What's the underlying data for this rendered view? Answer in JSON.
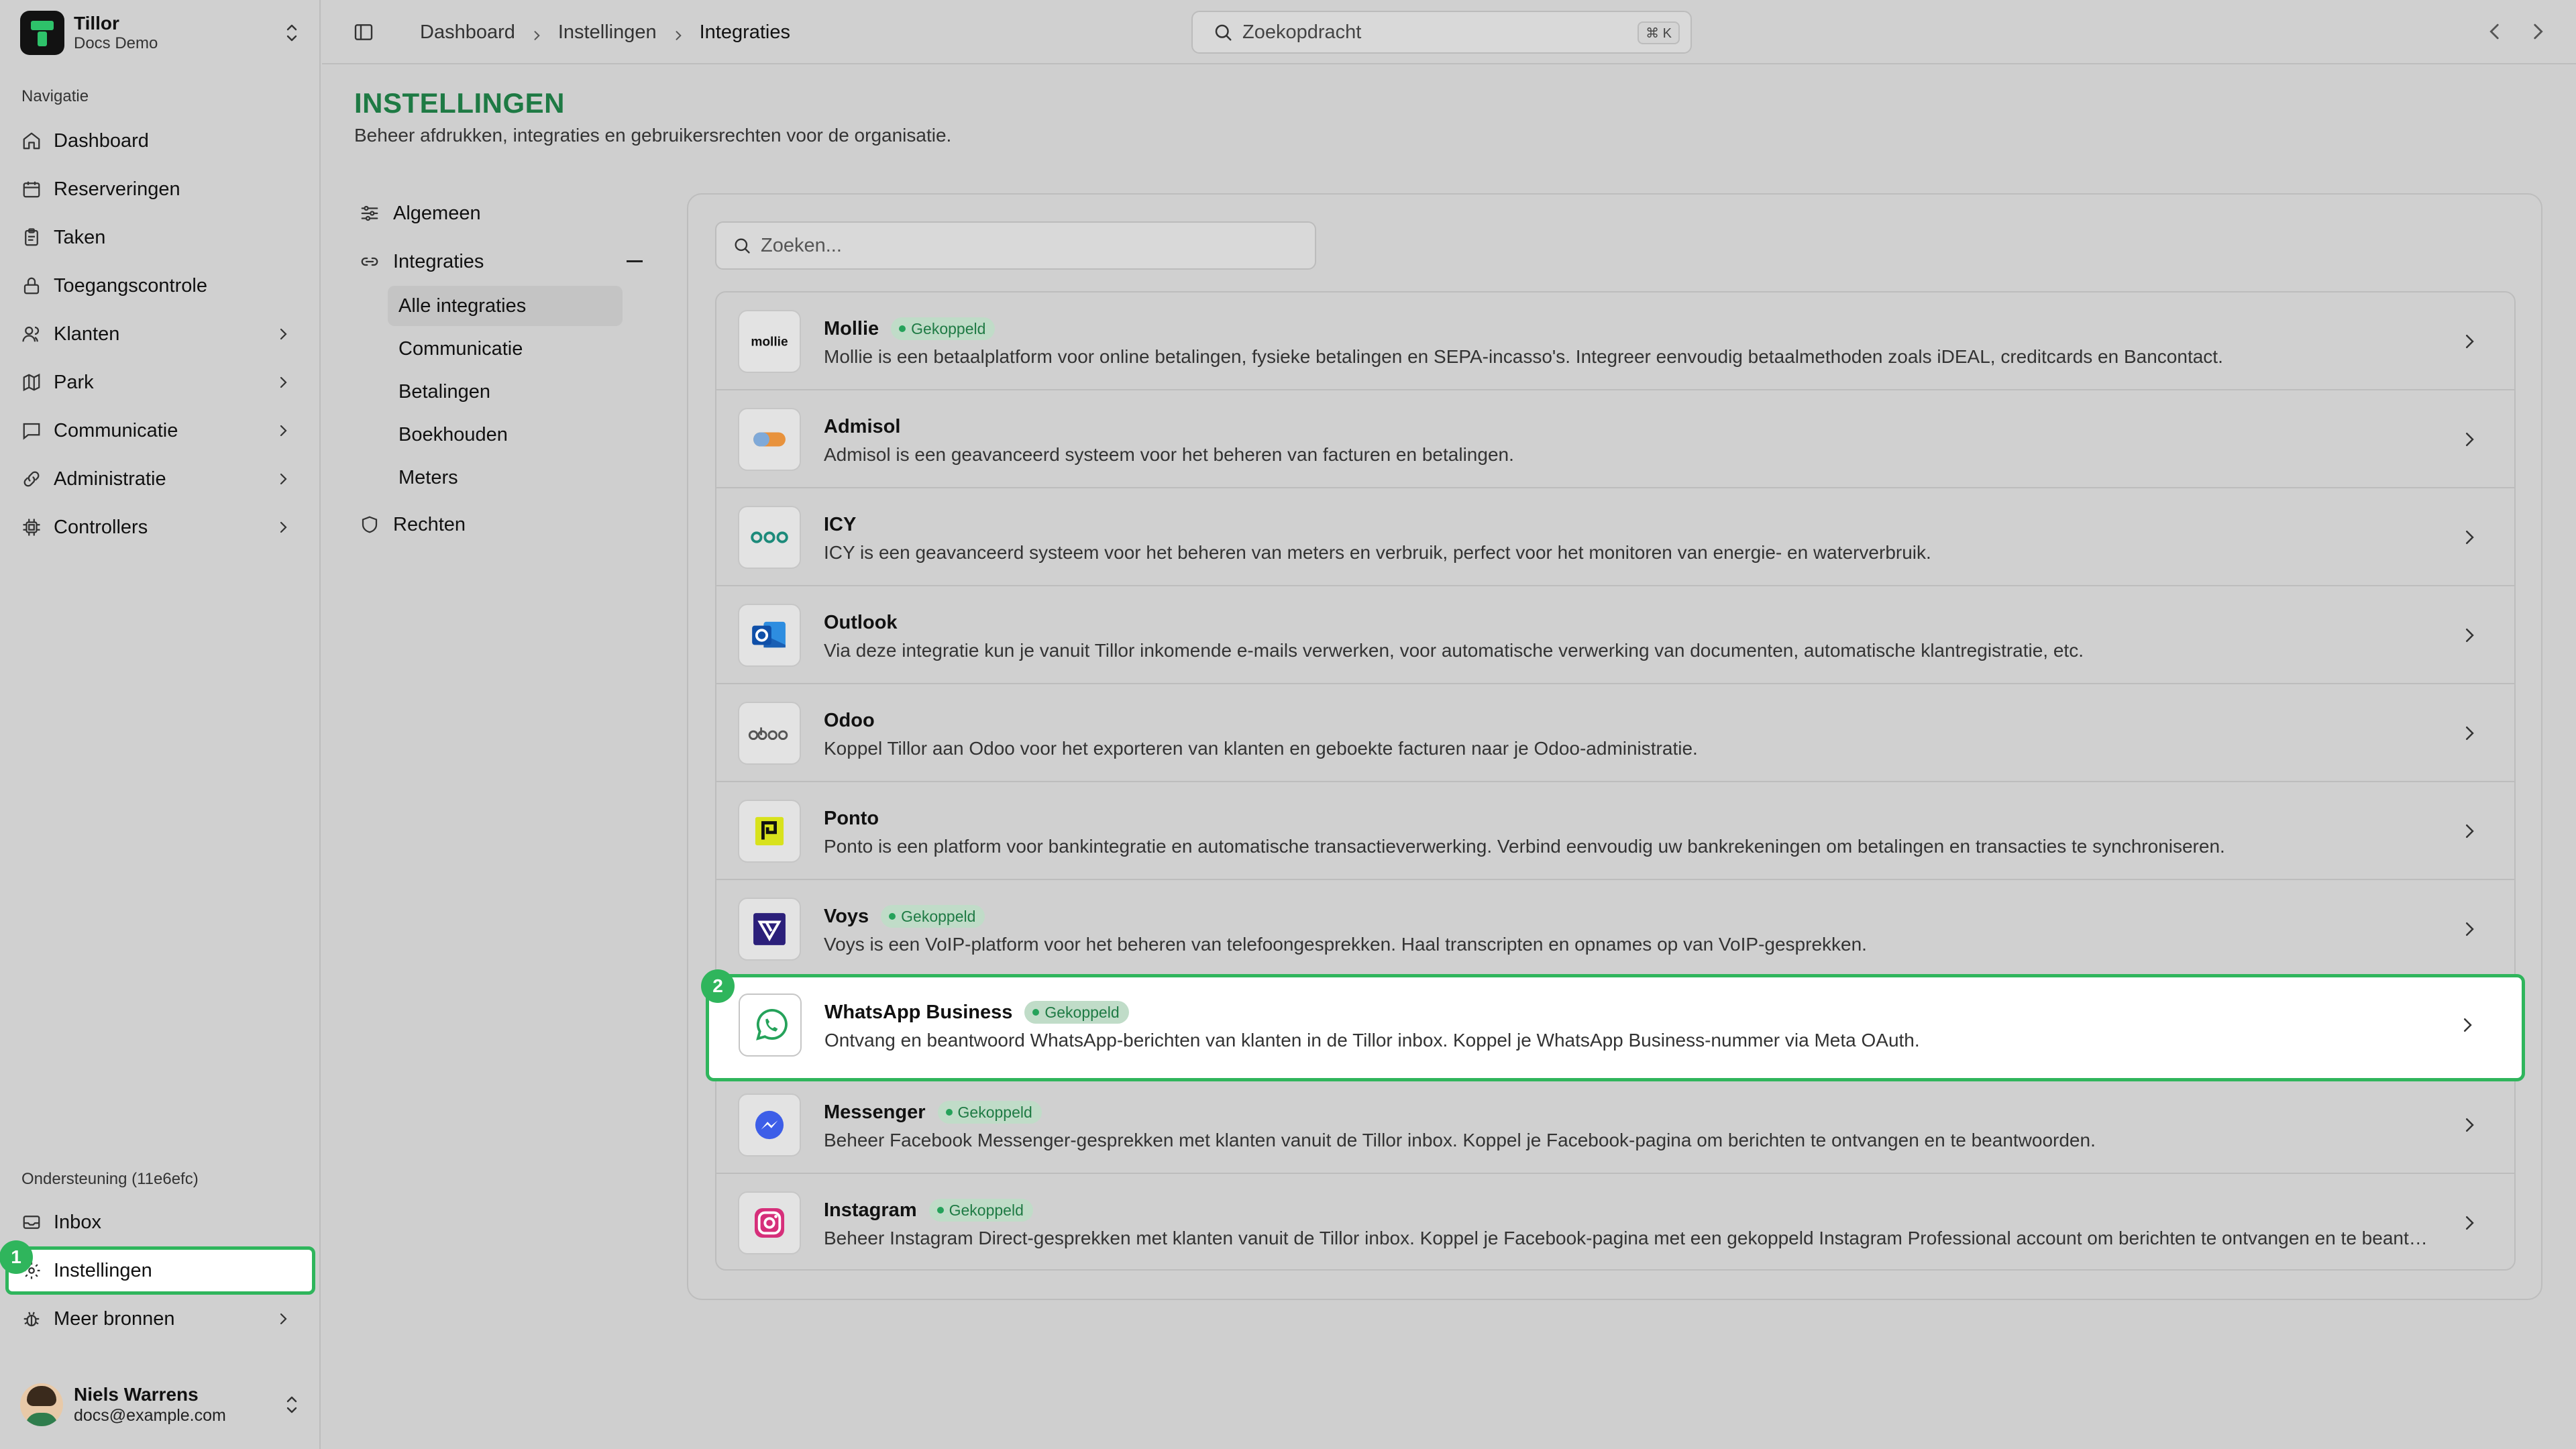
{
  "org": {
    "name": "Tillor",
    "subtitle": "Docs Demo"
  },
  "sidebar": {
    "section_label": "Navigatie",
    "items": [
      {
        "label": "Dashboard",
        "icon": "home-icon",
        "expandable": false
      },
      {
        "label": "Reserveringen",
        "icon": "calendar-icon",
        "expandable": false
      },
      {
        "label": "Taken",
        "icon": "clipboard-icon",
        "expandable": false
      },
      {
        "label": "Toegangscontrole",
        "icon": "lock-icon",
        "expandable": false
      },
      {
        "label": "Klanten",
        "icon": "users-icon",
        "expandable": true
      },
      {
        "label": "Park",
        "icon": "map-icon",
        "expandable": true
      },
      {
        "label": "Communicatie",
        "icon": "message-icon",
        "expandable": true
      },
      {
        "label": "Administratie",
        "icon": "link-icon",
        "expandable": true
      },
      {
        "label": "Controllers",
        "icon": "chip-icon",
        "expandable": true
      }
    ],
    "support_label": "Ondersteuning (11e6efc)",
    "support_items": [
      {
        "label": "Inbox",
        "icon": "inbox-icon"
      },
      {
        "label": "Instellingen",
        "icon": "gear-icon",
        "step": "1"
      },
      {
        "label": "Meer bronnen",
        "icon": "bug-icon"
      }
    ]
  },
  "user": {
    "name": "Niels Warrens",
    "email": "docs@example.com"
  },
  "topbar": {
    "breadcrumb": [
      "Dashboard",
      "Instellingen",
      "Integraties"
    ],
    "search_placeholder": "Zoekopdracht",
    "shortcut": "⌘ K"
  },
  "page": {
    "title": "INSTELLINGEN",
    "subtitle": "Beheer afdrukken, integraties en gebruikersrechten voor de organisatie."
  },
  "settings_nav": {
    "general": "Algemeen",
    "integrations": "Integraties",
    "integration_children": [
      "Alle integraties",
      "Communicatie",
      "Betalingen",
      "Boekhouden",
      "Meters"
    ],
    "rights": "Rechten"
  },
  "integrations": {
    "search_placeholder": "Zoeken...",
    "connected_label": "Gekoppeld",
    "items": [
      {
        "name": "Mollie",
        "connected": true,
        "logo": "mollie-logo",
        "description": "Mollie is een betaalplatform voor online betalingen, fysieke betalingen en SEPA-incasso's. Integreer eenvoudig betaalmethoden zoals iDEAL, creditcards en Bancontact."
      },
      {
        "name": "Admisol",
        "connected": false,
        "logo": "admisol-logo",
        "description": "Admisol is een geavanceerd systeem voor het beheren van facturen en betalingen."
      },
      {
        "name": "ICY",
        "connected": false,
        "logo": "icy-logo",
        "description": "ICY is een geavanceerd systeem voor het beheren van meters en verbruik, perfect voor het monitoren van energie- en waterverbruik."
      },
      {
        "name": "Outlook",
        "connected": false,
        "logo": "outlook-logo",
        "description": "Via deze integratie kun je vanuit Tillor inkomende e-mails verwerken, voor automatische verwerking van documenten, automatische klantregistratie, etc."
      },
      {
        "name": "Odoo",
        "connected": false,
        "logo": "odoo-logo",
        "description": "Koppel Tillor aan Odoo voor het exporteren van klanten en geboekte facturen naar je Odoo-administratie."
      },
      {
        "name": "Ponto",
        "connected": false,
        "logo": "ponto-logo",
        "description": "Ponto is een platform voor bankintegratie en automatische transactieverwerking. Verbind eenvoudig uw bankrekeningen om betalingen en transacties te synchroniseren."
      },
      {
        "name": "Voys",
        "connected": true,
        "logo": "voys-logo",
        "description": "Voys is een VoIP-platform voor het beheren van telefoongesprekken. Haal transcripten en opnames op van VoIP-gesprekken."
      },
      {
        "name": "WhatsApp Business",
        "connected": true,
        "logo": "whatsapp-logo",
        "step": "2",
        "description": "Ontvang en beantwoord WhatsApp-berichten van klanten in de Tillor inbox. Koppel je WhatsApp Business-nummer via Meta OAuth."
      },
      {
        "name": "Messenger",
        "connected": true,
        "logo": "messenger-logo",
        "description": "Beheer Facebook Messenger-gesprekken met klanten vanuit de Tillor inbox. Koppel je Facebook-pagina om berichten te ontvangen en te beantwoorden."
      },
      {
        "name": "Instagram",
        "connected": true,
        "logo": "instagram-logo",
        "description": "Beheer Instagram Direct-gesprekken met klanten vanuit de Tillor inbox. Koppel je Facebook-pagina met een gekoppeld Instagram Professional account om berichten te ontvangen en te beantwoorden."
      }
    ]
  },
  "colors": {
    "accent": "#1e7a44",
    "highlight": "#2fb55c",
    "badge_bg": "#c0dcc8"
  }
}
